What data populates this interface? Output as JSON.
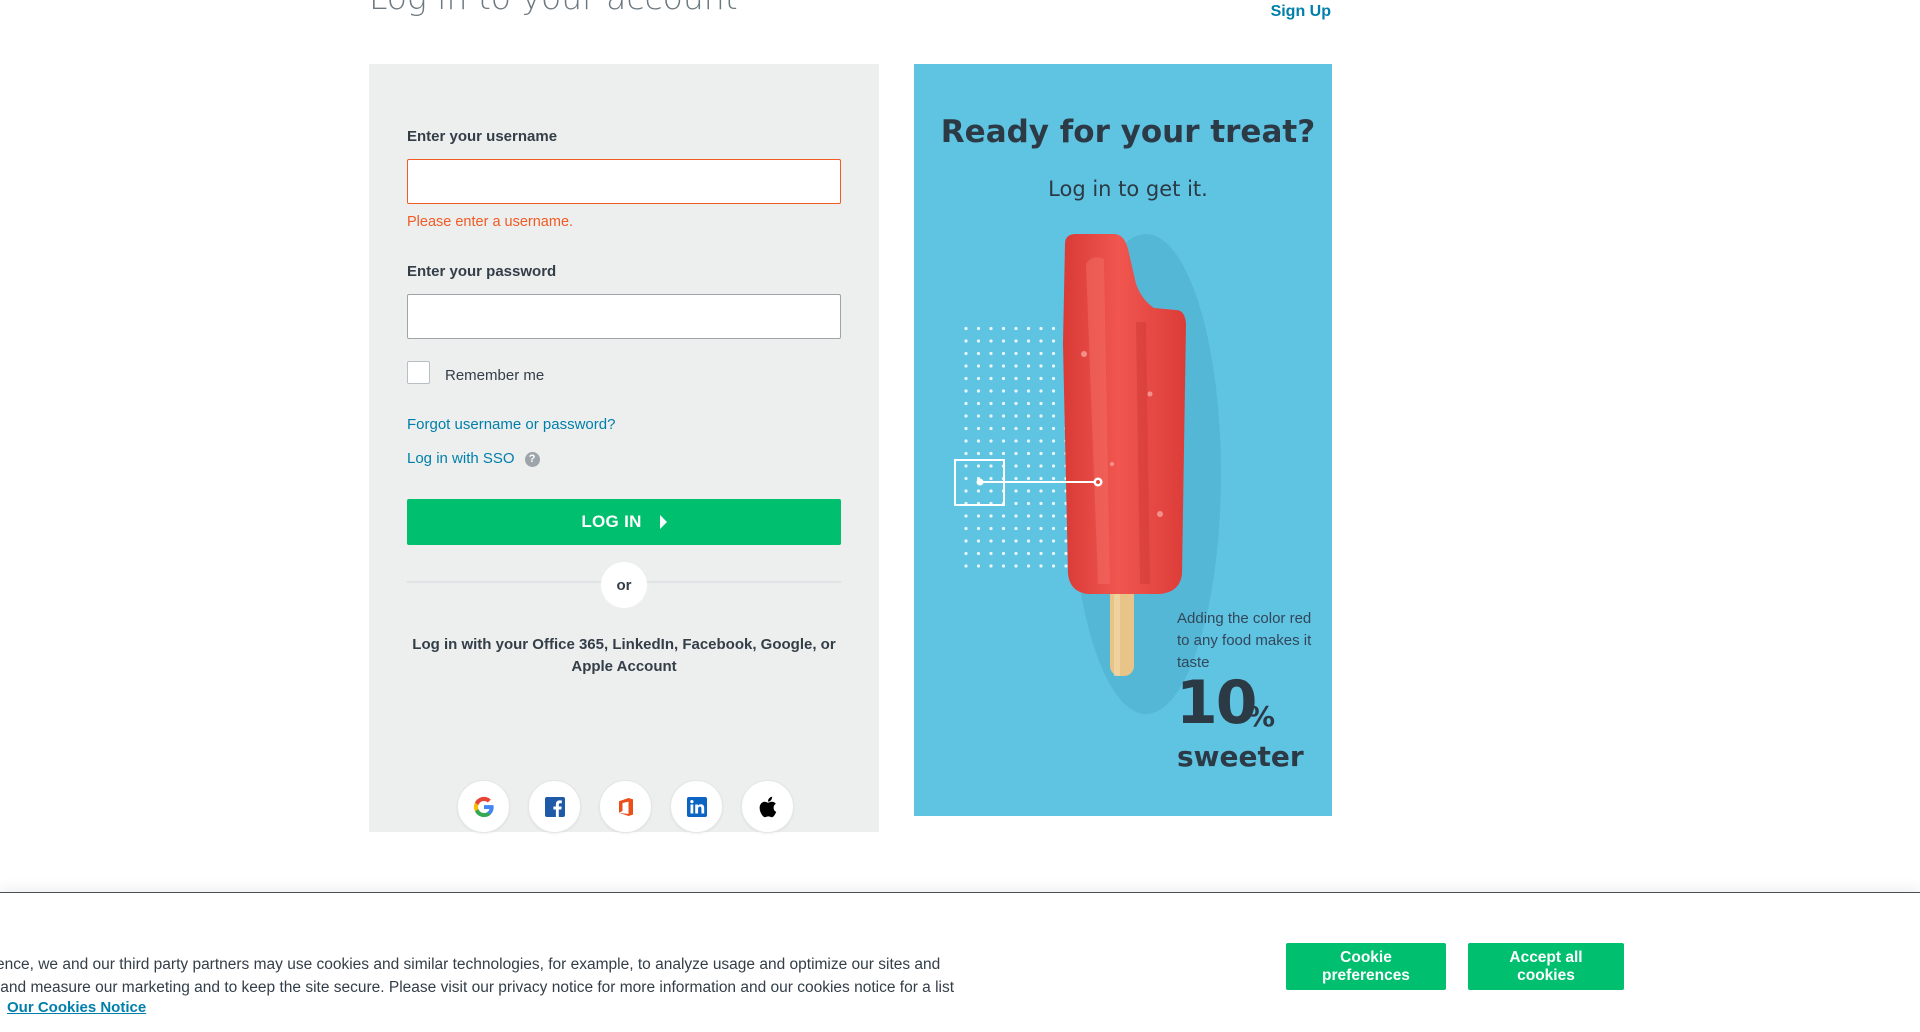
{
  "header": {
    "title": "Log in to your account",
    "signup_label": "Sign Up"
  },
  "form": {
    "username_label": "Enter your username",
    "username_value": "",
    "username_error": "Please enter a username.",
    "password_label": "Enter your password",
    "password_value": "",
    "remember_label": "Remember me",
    "forgot_link": "Forgot username or password?",
    "sso_link": "Log in with SSO",
    "sso_help_glyph": "?",
    "login_button": "LOG IN",
    "divider_label": "or",
    "social_text": "Log in with your Office 365, LinkedIn, Facebook, Google, or Apple Account",
    "social_buttons": [
      {
        "icon": "google-icon"
      },
      {
        "icon": "facebook-icon"
      },
      {
        "icon": "office-icon"
      },
      {
        "icon": "linkedin-icon"
      },
      {
        "icon": "apple-icon"
      }
    ]
  },
  "promo": {
    "title": "Ready for your treat?",
    "subtitle": "Log in to get it.",
    "fact": "Adding the color red to any food makes it taste",
    "big_number": "10",
    "percent": "%",
    "sweeter": "sweeter",
    "colors": {
      "background": "#5fc3e2",
      "popsicle": "#e8453f"
    }
  },
  "cookie_banner": {
    "text_line1": "ence, we and our third party partners may use cookies and similar technologies, for example, to analyze usage and optimize our sites and",
    "text_line2": " and measure our marketing and to keep the site secure. Please visit our privacy notice for more information and our cookies notice for a list",
    "notice_link": "Our Cookies Notice",
    "preferences_button": "Cookie preferences",
    "accept_button": "Accept all cookies"
  },
  "colors": {
    "accent_green": "#00bf6f",
    "link_blue": "#007faa",
    "error_orange": "#f05b24"
  }
}
